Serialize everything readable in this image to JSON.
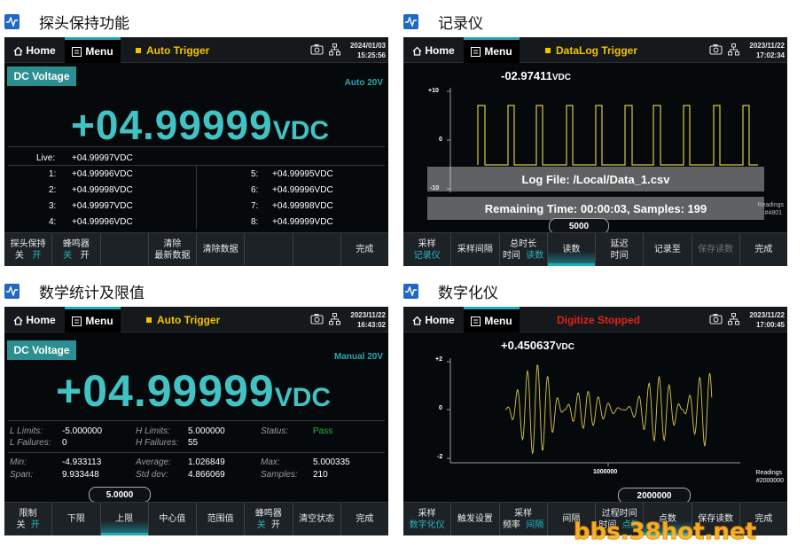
{
  "sections": [
    {
      "title": "探头保持功能"
    },
    {
      "title": "记录仪"
    },
    {
      "title": "数学统计及限值"
    },
    {
      "title": "数字化仪"
    }
  ],
  "screens": [
    {
      "home": "Home",
      "menu": "Menu",
      "trigger": "Auto Trigger",
      "date": "2024/01/03",
      "time": "15:25:56",
      "function": "DC Voltage",
      "range": "Auto 20V",
      "reading": "+04.99999",
      "unit": "VDC",
      "live_label": "Live:",
      "live_value": "+04.99997VDC",
      "readings": [
        {
          "idx": "1:",
          "val": "+04.99996VDC"
        },
        {
          "idx": "2:",
          "val": "+04.99998VDC"
        },
        {
          "idx": "3:",
          "val": "+04.99997VDC"
        },
        {
          "idx": "4:",
          "val": "+04.99996VDC"
        },
        {
          "idx": "5:",
          "val": "+04.99995VDC"
        },
        {
          "idx": "6:",
          "val": "+04.99996VDC"
        },
        {
          "idx": "7:",
          "val": "+04.99998VDC"
        },
        {
          "idx": "8:",
          "val": "+04.99999VDC"
        }
      ],
      "softkeys": [
        {
          "label": "探头保持",
          "opt1": "关",
          "opt2": "开",
          "selected_opt": 2
        },
        {
          "label": "蜂鸣器",
          "opt1": "关",
          "opt2": "开",
          "selected_opt": 1
        },
        {
          "label": ""
        },
        {
          "label": "清除",
          "sub": "最新数据"
        },
        {
          "label": "清除数据"
        },
        {
          "label": ""
        },
        {
          "label": ""
        },
        {
          "label": "完成"
        }
      ]
    },
    {
      "home": "Home",
      "menu": "Menu",
      "trigger": "DataLog Trigger",
      "date": "2023/11/22",
      "time": "17:02:34",
      "reading": "-02.97411",
      "unit": "VDC",
      "y_ticks": [
        "+10",
        "0",
        "-10"
      ],
      "log_file": "Log File: /Local/Data_1.csv",
      "remaining": "Remaining Time: 00:00:03, Samples: 199",
      "readings_label": "Readings",
      "readings_count": "#4801",
      "popup_value": "5000",
      "softkeys": [
        {
          "label": "采样",
          "sub": "记录仪",
          "sub_on": true
        },
        {
          "label": "采样间隔"
        },
        {
          "label": "总时长",
          "opt1": "时间",
          "opt2": "读数",
          "selected_opt": 2
        },
        {
          "label": "读数",
          "selected": true
        },
        {
          "label": "延迟",
          "sub": "时间"
        },
        {
          "label": "记录至"
        },
        {
          "label": "保存读数",
          "disabled": true
        },
        {
          "label": "完成"
        }
      ]
    },
    {
      "home": "Home",
      "menu": "Menu",
      "trigger": "Auto Trigger",
      "date": "2023/11/22",
      "time": "16:43:02",
      "function": "DC Voltage",
      "range": "Manual 20V",
      "reading": "+04.99999",
      "unit": "VDC",
      "limits": {
        "l_limits_label": "L Limits:",
        "l_limits": "-5.000000",
        "h_limits_label": "H Limits:",
        "h_limits": "5.000000",
        "status_label": "Status:",
        "status": "Pass",
        "l_failures_label": "L Failures:",
        "l_failures": "0",
        "h_failures_label": "H Failures:",
        "h_failures": "55"
      },
      "stats": {
        "min_label": "Min:",
        "min": "-4.933113",
        "avg_label": "Average:",
        "avg": "1.026849",
        "max_label": "Max:",
        "max": "5.000335",
        "span_label": "Span:",
        "span": "9.933448",
        "std_label": "Std dev:",
        "std": "4.866069",
        "samples_label": "Samples:",
        "samples": "210"
      },
      "popup_value": "5.0000",
      "softkeys": [
        {
          "label": "限制",
          "opt1": "关",
          "opt2": "开",
          "selected_opt": 2
        },
        {
          "label": "下限"
        },
        {
          "label": "上限",
          "selected": true
        },
        {
          "label": "中心值"
        },
        {
          "label": "范围值"
        },
        {
          "label": "蜂鸣器",
          "opt1": "关",
          "opt2": "开",
          "selected_opt": 1
        },
        {
          "label": "清空状态"
        },
        {
          "label": "完成"
        }
      ]
    },
    {
      "home": "Home",
      "menu": "Menu",
      "trigger": "Digitize Stopped",
      "date": "2023/11/22",
      "time": "17:00:45",
      "reading": "+0.450637",
      "unit": "VDC",
      "y_ticks": [
        "+2",
        "0",
        "-2"
      ],
      "x_tick": "1000000",
      "readings_label": "Readings",
      "readings_count": "#2000000",
      "popup_value": "2000000",
      "softkeys": [
        {
          "label": "采样",
          "sub": "数字化仪",
          "sub_on": true
        },
        {
          "label": "触发设置"
        },
        {
          "label": "采样",
          "opt1": "频率",
          "opt2": "间隔",
          "selected_opt": 2
        },
        {
          "label": "间隔"
        },
        {
          "label": "过程时间",
          "opt1": "时间",
          "opt2": "点数",
          "selected_opt": 2
        },
        {
          "label": "点数",
          "selected": true
        },
        {
          "label": "保存读数"
        },
        {
          "label": "完成"
        }
      ]
    }
  ],
  "watermark": "bbs.38hot.net",
  "colors": {
    "accent": "#41c2c3",
    "trigger": "#f2c400",
    "stopped": "#e0231b",
    "badge": "#2b8e91",
    "trace": "#d8c84a",
    "icon_blue": "#1f68c5"
  }
}
